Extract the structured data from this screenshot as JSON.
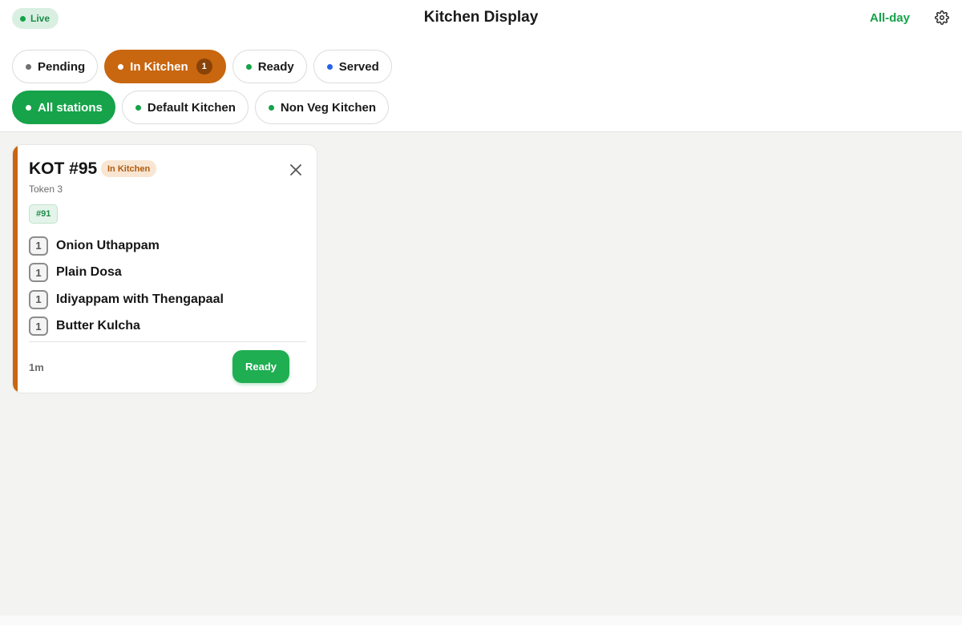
{
  "header": {
    "live_label": "Live",
    "title": "Kitchen Display",
    "allday_label": "All-day",
    "settings_icon": "gear-icon"
  },
  "status_filters": [
    {
      "label": "Pending",
      "dot_color": "#707070",
      "active": false
    },
    {
      "label": "In Kitchen",
      "dot_color": "#ffffff",
      "active": true,
      "count": "1"
    },
    {
      "label": "Ready",
      "dot_color": "#16a34a",
      "active": false
    },
    {
      "label": "Served",
      "dot_color": "#2563eb",
      "active": false
    }
  ],
  "station_filters": [
    {
      "label": "All stations",
      "dot_color": "#ffffff",
      "active": true
    },
    {
      "label": "Default Kitchen",
      "dot_color": "#16a34a",
      "active": false
    },
    {
      "label": "Non Veg Kitchen",
      "dot_color": "#16a34a",
      "active": false
    }
  ],
  "kot": {
    "title": "KOT #95",
    "status": "In Kitchen",
    "token": "Token 3",
    "order_tag": "#91",
    "items": [
      {
        "qty": "1",
        "name": "Onion Uthappam"
      },
      {
        "qty": "1",
        "name": "Plain Dosa"
      },
      {
        "qty": "1",
        "name": "Idiyappam with Thengapaal"
      },
      {
        "qty": "1",
        "name": "Butter Kulcha"
      }
    ],
    "elapsed": "1m",
    "action_label": "Ready"
  },
  "colors": {
    "accent_orange": "#c96610",
    "accent_green": "#16a34a",
    "background": "#f3f3f1"
  }
}
